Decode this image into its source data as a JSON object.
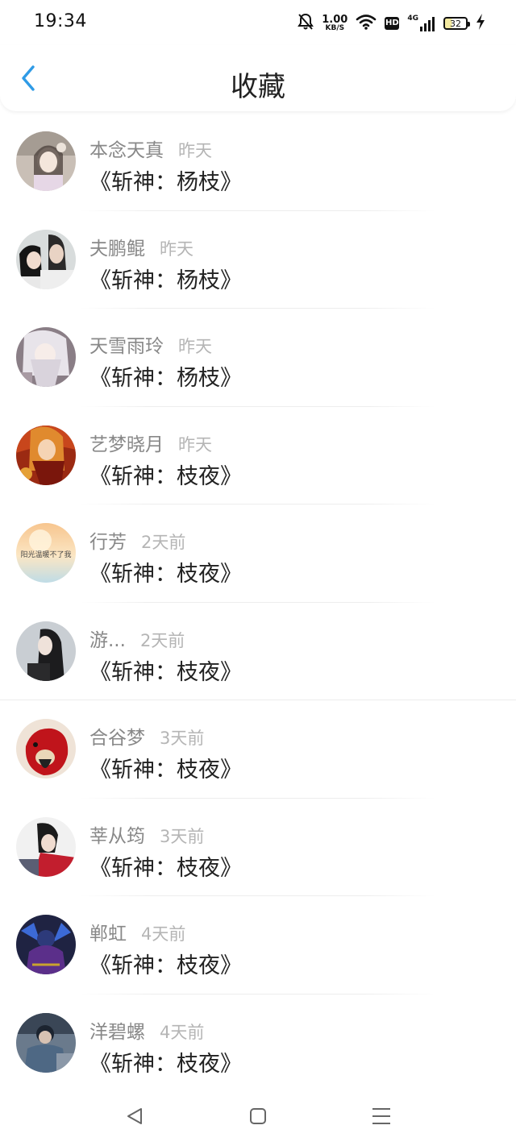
{
  "status_bar": {
    "time": "19:34",
    "net_speed_value": "1.00",
    "net_speed_unit": "KB/S",
    "hd_label": "HD",
    "network_type": "4G",
    "battery": "32"
  },
  "header": {
    "title": "收藏"
  },
  "favorites": [
    {
      "name": "本念天真",
      "time": "昨天",
      "title": "《斩神：杨枝》"
    },
    {
      "name": "夫鹏鲲",
      "time": "昨天",
      "title": "《斩神：杨枝》"
    },
    {
      "name": "天雪雨玲",
      "time": "昨天",
      "title": "《斩神：杨枝》"
    },
    {
      "name": "艺梦晓月",
      "time": "昨天",
      "title": "《斩神：枝夜》"
    },
    {
      "name": "行芳",
      "time": "2天前",
      "title": "《斩神：枝夜》"
    },
    {
      "name": "游...",
      "time": "2天前",
      "title": "《斩神：枝夜》"
    },
    {
      "name": "合谷梦",
      "time": "3天前",
      "title": "《斩神：枝夜》"
    },
    {
      "name": "莘从筠",
      "time": "3天前",
      "title": "《斩神：枝夜》"
    },
    {
      "name": "郸虹",
      "time": "4天前",
      "title": "《斩神：枝夜》"
    },
    {
      "name": "洋碧螺",
      "time": "4天前",
      "title": "《斩神：枝夜》"
    }
  ],
  "avatar_text": {
    "item_4": "阳光温暖不了我"
  },
  "colors": {
    "accent": "#2f9be6",
    "name_text": "#888888",
    "time_text": "#b5b5b5",
    "title_text": "#222222"
  }
}
